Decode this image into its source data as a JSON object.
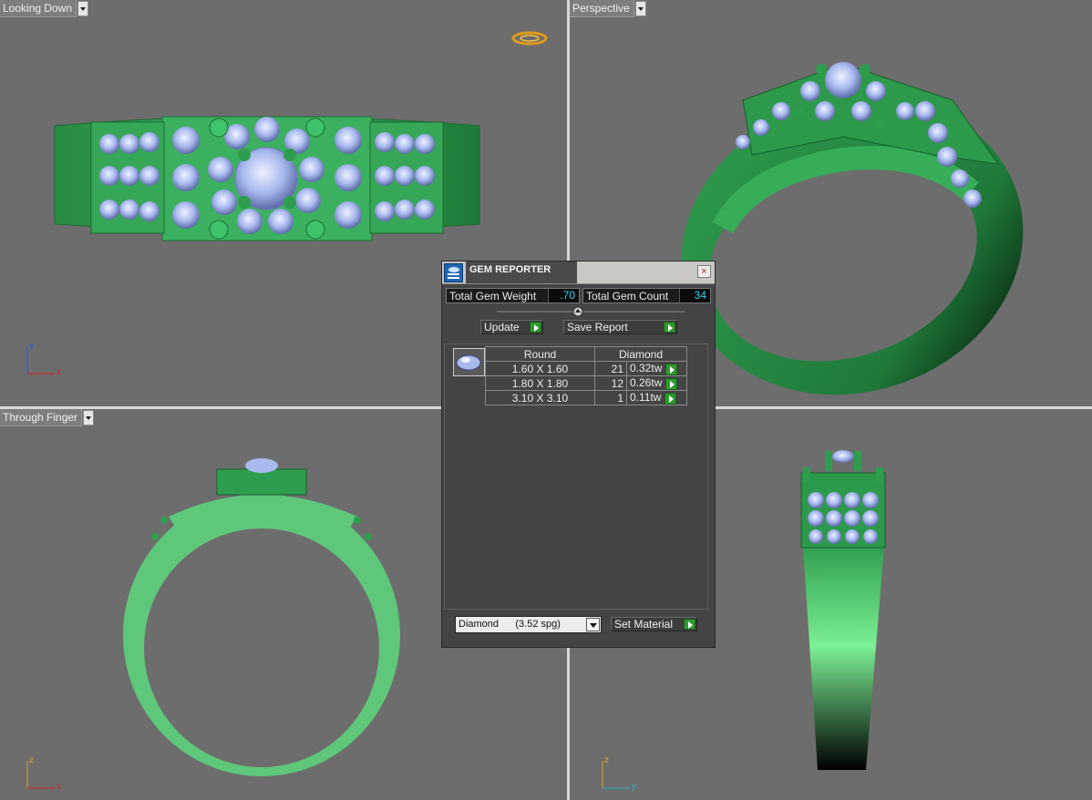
{
  "viewports": {
    "top_left": {
      "label": "Looking Down",
      "axis_h": "x",
      "axis_v": "y"
    },
    "top_right": {
      "label": "Perspective"
    },
    "bottom_left": {
      "label": "Through Finger",
      "axis_h": "x",
      "axis_v": "z"
    },
    "bottom_right": {
      "axis_h": "y",
      "axis_v": "z"
    }
  },
  "gem_reporter": {
    "title": "GEM REPORTER",
    "close_glyph": "×",
    "total_weight_label": "Total Gem Weight",
    "total_weight_value": ".70",
    "total_count_label": "Total Gem Count",
    "total_count_value": "34",
    "update_label": "Update",
    "save_report_label": "Save Report",
    "table_headers": {
      "shape": "Round",
      "material": "Diamond"
    },
    "rows": [
      {
        "size": "1.60 X 1.60",
        "count": "21",
        "weight": "0.32tw"
      },
      {
        "size": "1.80 X 1.80",
        "count": "12",
        "weight": "0.26tw"
      },
      {
        "size": "3.10 X 3.10",
        "count": "1",
        "weight": "0.11tw"
      }
    ],
    "material_select": "Diamond      (3.52 spg)",
    "set_material_label": "Set Material"
  },
  "colors": {
    "metal": "#2e9e4e",
    "metal_light": "#5cc879",
    "gem": "#a9b9ee",
    "viewport_bg": "#6d6d6d",
    "accent_green": "#2f9a2f"
  }
}
